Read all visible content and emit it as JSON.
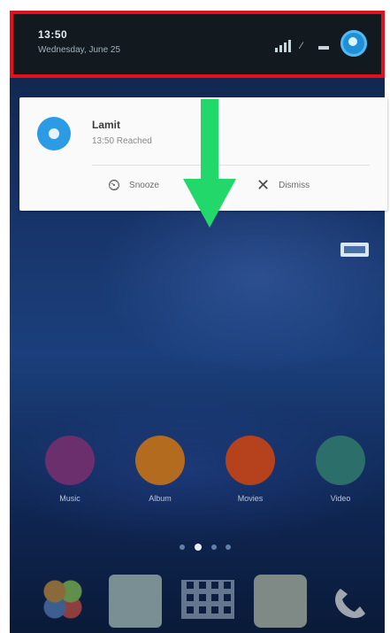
{
  "status_bar": {
    "time": "13:50",
    "date": "Wednesday, June 25",
    "icons": [
      "signal-icon",
      "wifi-icon",
      "battery-icon",
      "avatar-icon"
    ]
  },
  "notification": {
    "title": "Lamit",
    "subtitle": "13:50 Reached",
    "actions": [
      {
        "label": "Snooze",
        "icon": "snooze-icon"
      },
      {
        "label": "Dismiss",
        "icon": "dismiss-icon"
      }
    ]
  },
  "apps": [
    {
      "label": "Music",
      "color": "#7a2f78"
    },
    {
      "label": "Album",
      "color": "#b87826"
    },
    {
      "label": "Movies",
      "color": "#b94a24"
    },
    {
      "label": "Video",
      "color": "#2f7a74"
    }
  ],
  "colors": {
    "highlight_border": "#e0101c",
    "arrow": "#22d86a",
    "status_bg": "#121a20"
  }
}
